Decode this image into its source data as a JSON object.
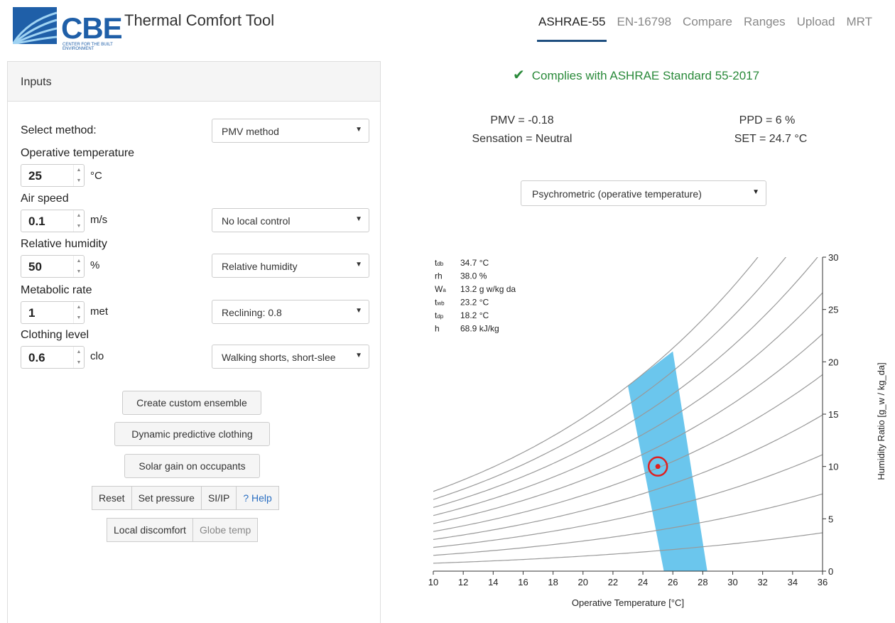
{
  "header": {
    "logo_text": "CBE",
    "logo_subtext": "CENTER FOR THE BUILT ENVIRONMENT",
    "title": "Thermal Comfort Tool",
    "tabs": [
      "ASHRAE-55",
      "EN-16798",
      "Compare",
      "Ranges",
      "Upload",
      "MRT"
    ],
    "active_tab": "ASHRAE-55"
  },
  "inputs": {
    "panel_title": "Inputs",
    "method_label": "Select method:",
    "method_value": "PMV method",
    "operative_temp": {
      "label": "Operative temperature",
      "value": "25",
      "unit": "°C"
    },
    "air_speed": {
      "label": "Air speed",
      "value": "0.1",
      "unit": "m/s",
      "select": "No local control"
    },
    "humidity": {
      "label": "Relative humidity",
      "value": "50",
      "unit": "%",
      "select": "Relative humidity"
    },
    "metabolic": {
      "label": "Metabolic rate",
      "value": "1",
      "unit": "met",
      "select": "Reclining: 0.8"
    },
    "clothing": {
      "label": "Clothing level",
      "value": "0.6",
      "unit": "clo",
      "select": "Walking shorts, short-slee"
    },
    "buttons": {
      "custom_ensemble": "Create custom ensemble",
      "dynamic_clothing": "Dynamic predictive clothing",
      "solar_gain": "Solar gain on occupants",
      "reset": "Reset",
      "set_pressure": "Set pressure",
      "si_ip": "SI/IP",
      "help": "? Help",
      "local_discomfort": "Local discomfort",
      "globe_temp": "Globe temp"
    }
  },
  "results": {
    "compliance": "Complies with ASHRAE Standard 55-2017",
    "pmv": "PMV = -0.18",
    "ppd": "PPD = 6 %",
    "sensation": "Sensation = Neutral",
    "set": "SET = 24.7 °C",
    "chart_select": "Psychrometric (operative temperature)"
  },
  "chart_readout": [
    {
      "k": "t",
      "sub": "db",
      "v": "34.7  °C"
    },
    {
      "k": "rh",
      "sub": "",
      "v": "38.0  %"
    },
    {
      "k": "W",
      "sub": "a",
      "v": "13.2  g w/kg da"
    },
    {
      "k": "t",
      "sub": "wb",
      "v": "23.2  °C"
    },
    {
      "k": "t",
      "sub": "dp",
      "v": "18.2  °C"
    },
    {
      "k": "h",
      "sub": "",
      "v": "68.9  kJ/kg"
    }
  ],
  "colors": {
    "comfort_zone": "#5bc0eb",
    "point": "#e02020",
    "curve": "#999999",
    "active_tab": "#1f4f80"
  },
  "chart_data": {
    "type": "scatter",
    "xlabel": "Operative Temperature [°C]",
    "ylabel": "Humidity Ratio [g_w / kg_da]",
    "xlim": [
      10,
      36
    ],
    "ylim": [
      0,
      30
    ],
    "xticks": [
      10,
      12,
      14,
      16,
      18,
      20,
      22,
      24,
      26,
      28,
      30,
      32,
      34,
      36
    ],
    "yticks": [
      0,
      5,
      10,
      15,
      20,
      25,
      30
    ],
    "rh_curves": [
      0.1,
      0.2,
      0.3,
      0.4,
      0.5,
      0.6,
      0.7,
      0.8,
      0.9,
      1.0
    ],
    "comfort_zone": [
      [
        23.0,
        17.7
      ],
      [
        26.0,
        21.0
      ],
      [
        28.3,
        0
      ],
      [
        25.4,
        0
      ]
    ],
    "point": {
      "x": 25,
      "y": 10
    }
  }
}
